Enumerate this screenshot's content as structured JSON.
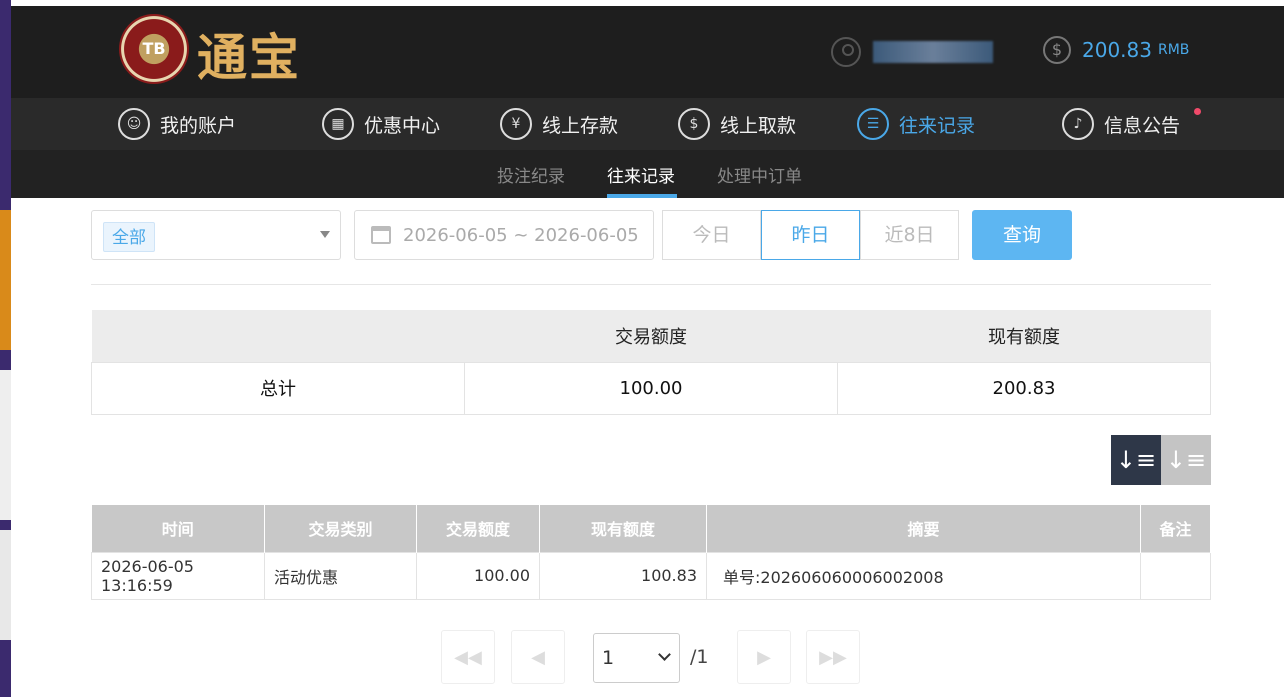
{
  "header": {
    "logo_badge": "TB",
    "logo_text": "通宝",
    "balance_amount": "200.83",
    "balance_unit": "RMB"
  },
  "nav": {
    "items": [
      {
        "label": "我的账户",
        "icon": "user-circle-icon"
      },
      {
        "label": "优惠中心",
        "icon": "gift-icon"
      },
      {
        "label": "线上存款",
        "icon": "deposit-icon"
      },
      {
        "label": "线上取款",
        "icon": "withdraw-icon"
      },
      {
        "label": "往来记录",
        "icon": "records-icon",
        "active": true
      },
      {
        "label": "信息公告",
        "icon": "bell-icon",
        "has_dot": true
      }
    ]
  },
  "subnav": {
    "items": [
      "投注纪录",
      "往来记录",
      "处理中订单"
    ],
    "active_index": 1
  },
  "filters": {
    "type_selected": "全部",
    "date_range": "2026-06-05 ~ 2026-06-05",
    "quick_ranges": [
      "今日",
      "昨日",
      "近8日"
    ],
    "quick_active_index": 1,
    "query_label": "查询"
  },
  "summary": {
    "headers": [
      "",
      "交易额度",
      "现有额度"
    ],
    "row": [
      "总计",
      "100.00",
      "200.83"
    ]
  },
  "records": {
    "headers": [
      "时间",
      "交易类别",
      "交易额度",
      "现有额度",
      "摘要",
      "备注"
    ],
    "rows": [
      [
        "2026-06-05 13:16:59",
        "活动优惠",
        "100.00",
        "100.83",
        "单号:202606060006002008",
        ""
      ]
    ]
  },
  "pagination": {
    "current_page": "1",
    "total_label": "/1"
  },
  "colors": {
    "accent": "#4aa8e8",
    "header_bg": "#1e1e1e",
    "nav_bg": "#2a2a2a",
    "query_button": "#5db6f2",
    "notify_dot": "#f04a6a"
  }
}
